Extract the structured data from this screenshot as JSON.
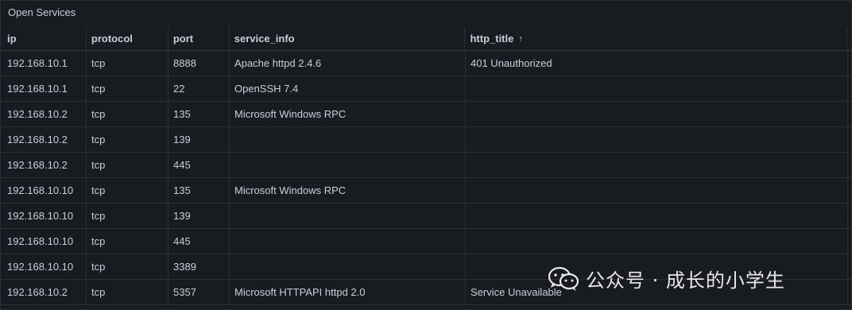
{
  "panel": {
    "title": "Open Services"
  },
  "columns": [
    "ip",
    "protocol",
    "port",
    "service_info",
    "http_title"
  ],
  "sort_indicator": "↑",
  "rows": [
    {
      "ip": "192.168.10.1",
      "protocol": "tcp",
      "port": "8888",
      "service_info": "Apache httpd 2.4.6",
      "http_title": "401 Unauthorized"
    },
    {
      "ip": "192.168.10.1",
      "protocol": "tcp",
      "port": "22",
      "service_info": "OpenSSH 7.4",
      "http_title": ""
    },
    {
      "ip": "192.168.10.2",
      "protocol": "tcp",
      "port": "135",
      "service_info": "Microsoft Windows RPC",
      "http_title": ""
    },
    {
      "ip": "192.168.10.2",
      "protocol": "tcp",
      "port": "139",
      "service_info": "",
      "http_title": ""
    },
    {
      "ip": "192.168.10.2",
      "protocol": "tcp",
      "port": "445",
      "service_info": "",
      "http_title": ""
    },
    {
      "ip": "192.168.10.10",
      "protocol": "tcp",
      "port": "135",
      "service_info": "Microsoft Windows RPC",
      "http_title": ""
    },
    {
      "ip": "192.168.10.10",
      "protocol": "tcp",
      "port": "139",
      "service_info": "",
      "http_title": ""
    },
    {
      "ip": "192.168.10.10",
      "protocol": "tcp",
      "port": "445",
      "service_info": "",
      "http_title": ""
    },
    {
      "ip": "192.168.10.10",
      "protocol": "tcp",
      "port": "3389",
      "service_info": "",
      "http_title": ""
    },
    {
      "ip": "192.168.10.2",
      "protocol": "tcp",
      "port": "5357",
      "service_info": "Microsoft HTTPAPI httpd 2.0",
      "http_title": "Service Unavailable"
    }
  ],
  "watermark": {
    "text": "公众号 · 成长的小学生",
    "icon": "wechat-icon"
  }
}
